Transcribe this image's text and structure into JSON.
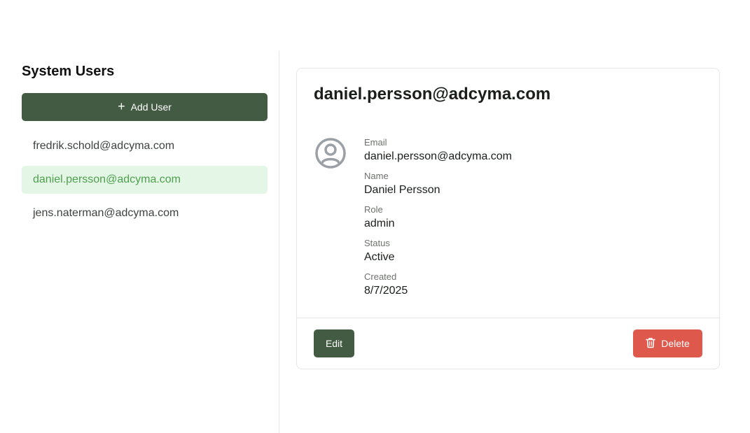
{
  "sidebar": {
    "title": "System Users",
    "add_button_label": "Add User",
    "add_icon": "plus-icon",
    "users": [
      {
        "email": "fredrik.schold@adcyma.com",
        "selected": false
      },
      {
        "email": "daniel.persson@adcyma.com",
        "selected": true
      },
      {
        "email": "jens.naterman@adcyma.com",
        "selected": false
      }
    ]
  },
  "detail": {
    "title": "daniel.persson@adcyma.com",
    "avatar_icon": "user-circle-icon",
    "fields": [
      {
        "label": "Email",
        "value": "daniel.persson@adcyma.com"
      },
      {
        "label": "Name",
        "value": "Daniel Persson"
      },
      {
        "label": "Role",
        "value": "admin"
      },
      {
        "label": "Status",
        "value": "Active"
      },
      {
        "label": "Created",
        "value": "8/7/2025"
      }
    ],
    "edit_label": "Edit",
    "delete_label": "Delete",
    "delete_icon": "trash-icon"
  },
  "colors": {
    "primary": "#435a43",
    "danger": "#de584c",
    "selected_bg": "#e4f7e6",
    "selected_text": "#4ea04e"
  }
}
